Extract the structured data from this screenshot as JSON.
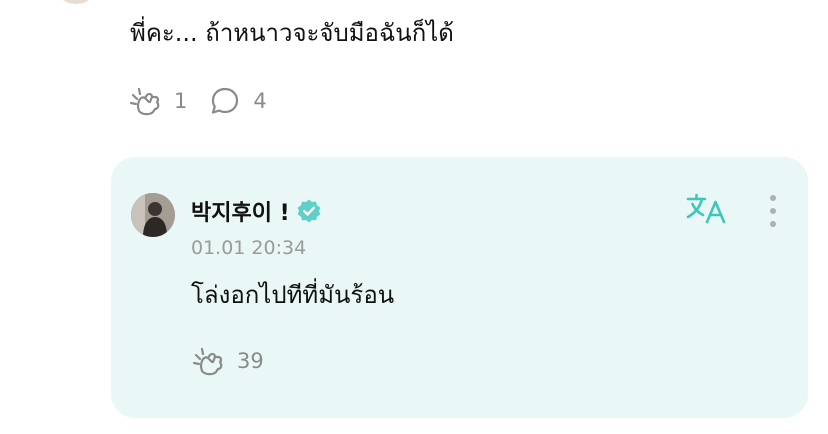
{
  "comment": {
    "text": "พี่คะ... ถ้าหนาวจะจับมือฉันก็ได้",
    "like_count": "1",
    "reply_count": "4"
  },
  "reply": {
    "author": "박지후이 !",
    "timestamp": "01.01 20:34",
    "text": "โล่งอกไปทีที่มันร้อน",
    "like_count": "39",
    "verified_color": "#5fd0c7",
    "accent_color": "#3ec6b8"
  },
  "icons": {
    "like": "cheering-hand-icon",
    "comment": "speech-bubble-icon",
    "translate": "translate-icon",
    "more": "more-vertical-icon",
    "verified": "verified-badge-icon"
  }
}
